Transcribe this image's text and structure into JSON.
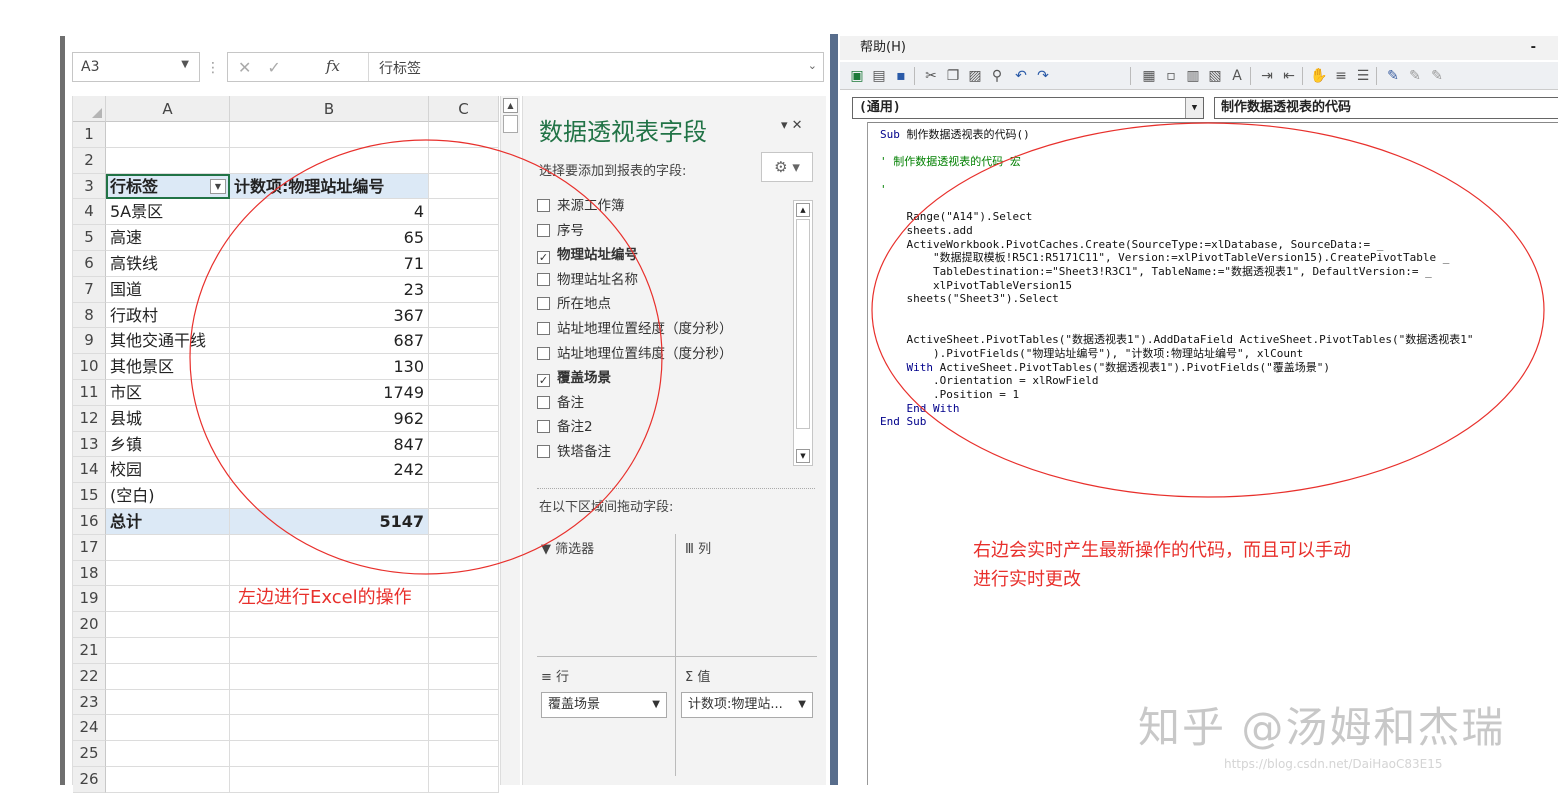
{
  "excel": {
    "name_box": "A3",
    "formula_value": "行标签",
    "columns": [
      "A",
      "B",
      "C"
    ],
    "rows": [
      {
        "n": "1",
        "a": "",
        "b": ""
      },
      {
        "n": "2",
        "a": "",
        "b": ""
      },
      {
        "n": "3",
        "a": "行标签",
        "b": "计数项:物理站址编号"
      },
      {
        "n": "4",
        "a": "5A景区",
        "b": "4"
      },
      {
        "n": "5",
        "a": "高速",
        "b": "65"
      },
      {
        "n": "6",
        "a": "高铁线",
        "b": "71"
      },
      {
        "n": "7",
        "a": "国道",
        "b": "23"
      },
      {
        "n": "8",
        "a": "行政村",
        "b": "367"
      },
      {
        "n": "9",
        "a": "其他交通干线",
        "b": "687"
      },
      {
        "n": "10",
        "a": "其他景区",
        "b": "130"
      },
      {
        "n": "11",
        "a": "市区",
        "b": "1749"
      },
      {
        "n": "12",
        "a": "县城",
        "b": "962"
      },
      {
        "n": "13",
        "a": "乡镇",
        "b": "847"
      },
      {
        "n": "14",
        "a": "校园",
        "b": "242"
      },
      {
        "n": "15",
        "a": "(空白)",
        "b": ""
      },
      {
        "n": "16",
        "a": "总计",
        "b": "5147"
      },
      {
        "n": "17",
        "a": "",
        "b": ""
      },
      {
        "n": "18",
        "a": "",
        "b": ""
      },
      {
        "n": "19",
        "a": "",
        "b": ""
      },
      {
        "n": "20",
        "a": "",
        "b": ""
      },
      {
        "n": "21",
        "a": "",
        "b": ""
      },
      {
        "n": "22",
        "a": "",
        "b": ""
      },
      {
        "n": "23",
        "a": "",
        "b": ""
      },
      {
        "n": "24",
        "a": "",
        "b": ""
      },
      {
        "n": "25",
        "a": "",
        "b": ""
      },
      {
        "n": "26",
        "a": "",
        "b": ""
      }
    ]
  },
  "pivot_pane": {
    "title": "数据透视表字段",
    "subtitle": "选择要添加到报表的字段:",
    "fields": [
      {
        "label": "来源工作簿",
        "checked": false
      },
      {
        "label": "序号",
        "checked": false
      },
      {
        "label": "物理站址编号",
        "checked": true
      },
      {
        "label": "物理站址名称",
        "checked": false
      },
      {
        "label": "所在地点",
        "checked": false
      },
      {
        "label": "站址地理位置经度（度分秒）",
        "checked": false
      },
      {
        "label": "站址地理位置纬度（度分秒）",
        "checked": false
      },
      {
        "label": "覆盖场景",
        "checked": true
      },
      {
        "label": "备注",
        "checked": false
      },
      {
        "label": "备注2",
        "checked": false
      },
      {
        "label": "铁塔备注",
        "checked": false
      }
    ],
    "drag_label": "在以下区域间拖动字段:",
    "area_filter": "筛选器",
    "area_columns": "列",
    "area_rows": "行",
    "area_values": "值",
    "rows_value": "覆盖场景",
    "values_value": "计数项:物理站..."
  },
  "vba": {
    "menu_help": "帮助(H)",
    "object_combo": "(通用)",
    "proc_combo": "制作数据透视表的代码",
    "code_lines": [
      {
        "t": "Sub 制作数据透视表的代码()",
        "c": "kw0"
      },
      {
        "t": "",
        "c": ""
      },
      {
        "t": "' 制作数据透视表的代码 宏",
        "c": "cm"
      },
      {
        "t": "",
        "c": ""
      },
      {
        "t": "'",
        "c": "cm"
      },
      {
        "t": "",
        "c": ""
      },
      {
        "t": "    Range(\"A14\").Select",
        "c": ""
      },
      {
        "t": "    sheets.add",
        "c": ""
      },
      {
        "t": "    ActiveWorkbook.PivotCaches.Create(SourceType:=xlDatabase, SourceData:= _",
        "c": ""
      },
      {
        "t": "        \"数据提取模板!R5C1:R5171C11\", Version:=xlPivotTableVersion15).CreatePivotTable _",
        "c": ""
      },
      {
        "t": "        TableDestination:=\"Sheet3!R3C1\", TableName:=\"数据透视表1\", DefaultVersion:= _",
        "c": ""
      },
      {
        "t": "        xlPivotTableVersion15",
        "c": ""
      },
      {
        "t": "    sheets(\"Sheet3\").Select",
        "c": ""
      },
      {
        "t": "",
        "c": ""
      },
      {
        "t": "",
        "c": ""
      },
      {
        "t": "    ActiveSheet.PivotTables(\"数据透视表1\").AddDataField ActiveSheet.PivotTables(\"数据透视表1\"",
        "c": ""
      },
      {
        "t": "        ).PivotFields(\"物理站址编号\"), \"计数项:物理站址编号\", xlCount",
        "c": ""
      },
      {
        "t": "    With ActiveSheet.PivotTables(\"数据透视表1\").PivotFields(\"覆盖场景\")",
        "c": ""
      },
      {
        "t": "        .Orientation = xlRowField",
        "c": ""
      },
      {
        "t": "        .Position = 1",
        "c": ""
      },
      {
        "t": "    End With",
        "c": "kw"
      },
      {
        "t": "End Sub",
        "c": "kw"
      }
    ]
  },
  "annotations": {
    "left": "左边进行Excel的操作",
    "right_line1": "右边会实时产生最新操作的代码，而且可以手动",
    "right_line2": "进行实时更改",
    "watermark": "知乎 @汤姆和杰瑞",
    "watermark_url": "https://blog.csdn.net/DaiHaoC83E15",
    "color": "#e8302c"
  }
}
